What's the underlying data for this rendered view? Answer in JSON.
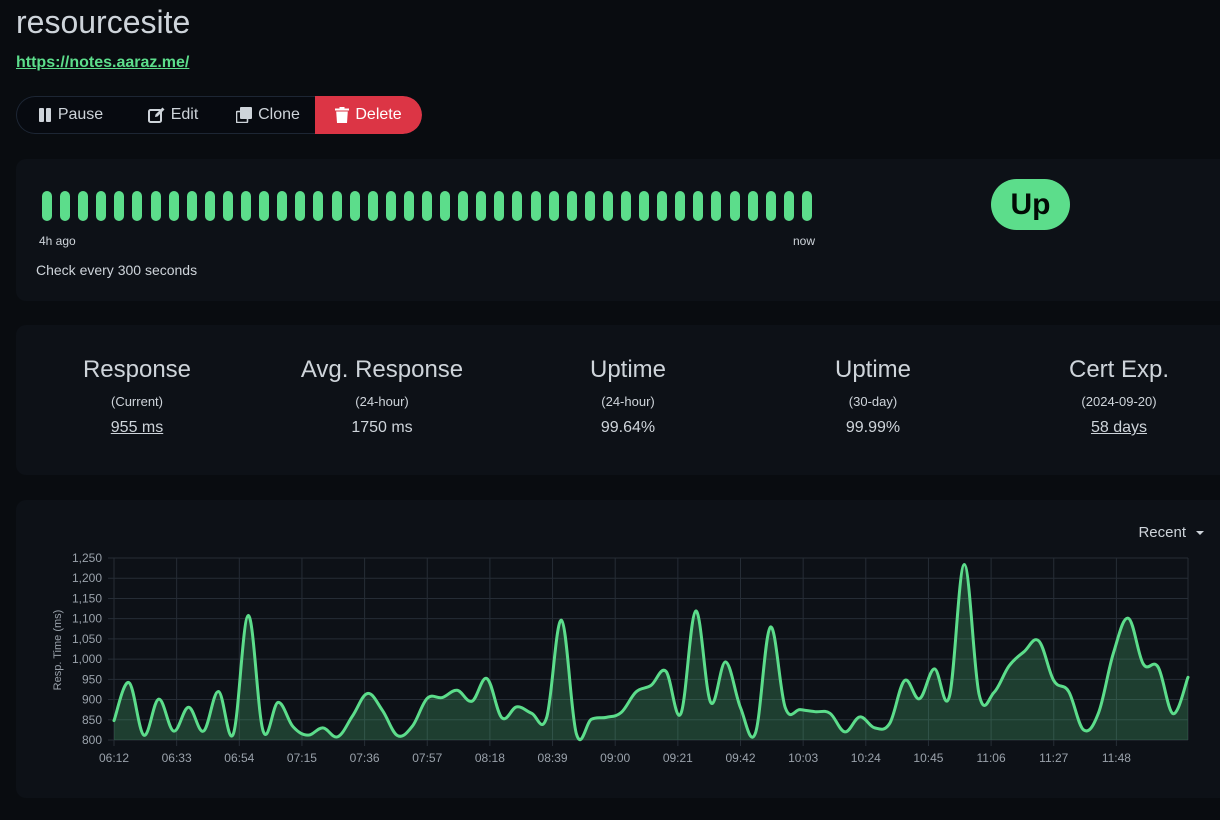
{
  "monitor": {
    "name": "resourcesite",
    "url": "https://notes.aaraz.me/"
  },
  "actions": {
    "pause": "Pause",
    "edit": "Edit",
    "clone": "Clone",
    "delete": "Delete"
  },
  "heartbeat": {
    "beat_count": 43,
    "beat_color": "#5cdd8b",
    "label_start": "4h ago",
    "label_end": "now",
    "check_text": "Check every 300 seconds",
    "status": "Up"
  },
  "stats": [
    {
      "title": "Response",
      "subtitle": "(Current)",
      "value": "955 ms",
      "link": true
    },
    {
      "title": "Avg. Response",
      "subtitle": "(24-hour)",
      "value": "1750 ms",
      "link": false
    },
    {
      "title": "Uptime",
      "subtitle": "(24-hour)",
      "value": "99.64%",
      "link": false
    },
    {
      "title": "Uptime",
      "subtitle": "(30-day)",
      "value": "99.99%",
      "link": false
    },
    {
      "title": "Cert Exp.",
      "subtitle": "(2024-09-20)",
      "value": "58 days",
      "link": true
    }
  ],
  "period_select": {
    "value": "Recent"
  },
  "colors": {
    "accent": "#5cdd8b",
    "danger": "#dc3545",
    "background": "#090c10",
    "card": "#0d1117"
  },
  "chart_data": {
    "type": "area",
    "ylabel": "Resp. Time (ms)",
    "xlabel": "",
    "ylim": [
      800,
      1250
    ],
    "yticks": [
      800,
      850,
      900,
      950,
      1000,
      1050,
      1100,
      1150,
      1200,
      1250
    ],
    "ytick_labels": [
      "800",
      "850",
      "900",
      "950",
      "1,000",
      "1,050",
      "1,100",
      "1,150",
      "1,200",
      "1,250"
    ],
    "xticks": [
      "06:12",
      "06:33",
      "06:54",
      "07:15",
      "07:36",
      "07:57",
      "08:18",
      "08:39",
      "09:00",
      "09:21",
      "09:42",
      "10:03",
      "10:24",
      "10:45",
      "11:06",
      "11:27",
      "11:48"
    ],
    "xtick_step_minutes": 21,
    "start_time": "06:12",
    "end_time": "12:02",
    "grid": true,
    "series": [
      {
        "color": "#5cdd8b",
        "points": [
          [
            "06:12",
            848
          ],
          [
            "06:17",
            942
          ],
          [
            "06:22",
            812
          ],
          [
            "06:27",
            901
          ],
          [
            "06:32",
            822
          ],
          [
            "06:37",
            881
          ],
          [
            "06:42",
            822
          ],
          [
            "06:47",
            920
          ],
          [
            "06:52",
            815
          ],
          [
            "06:57",
            1108
          ],
          [
            "07:02",
            822
          ],
          [
            "07:07",
            893
          ],
          [
            "07:12",
            833
          ],
          [
            "07:17",
            812
          ],
          [
            "07:22",
            830
          ],
          [
            "07:27",
            808
          ],
          [
            "07:32",
            860
          ],
          [
            "07:37",
            915
          ],
          [
            "07:42",
            873
          ],
          [
            "07:47",
            811
          ],
          [
            "07:52",
            834
          ],
          [
            "07:57",
            903
          ],
          [
            "08:02",
            905
          ],
          [
            "08:07",
            923
          ],
          [
            "08:12",
            896
          ],
          [
            "08:17",
            952
          ],
          [
            "08:22",
            855
          ],
          [
            "08:27",
            882
          ],
          [
            "08:32",
            866
          ],
          [
            "08:37",
            855
          ],
          [
            "08:42",
            1096
          ],
          [
            "08:47",
            815
          ],
          [
            "08:52",
            851
          ],
          [
            "08:57",
            856
          ],
          [
            "09:02",
            868
          ],
          [
            "09:07",
            919
          ],
          [
            "09:12",
            935
          ],
          [
            "09:17",
            970
          ],
          [
            "09:22",
            865
          ],
          [
            "09:27",
            1119
          ],
          [
            "09:32",
            893
          ],
          [
            "09:37",
            993
          ],
          [
            "09:42",
            880
          ],
          [
            "09:47",
            817
          ],
          [
            "09:52",
            1079
          ],
          [
            "09:57",
            880
          ],
          [
            "10:02",
            875
          ],
          [
            "10:07",
            870
          ],
          [
            "10:12",
            866
          ],
          [
            "10:17",
            820
          ],
          [
            "10:22",
            857
          ],
          [
            "10:27",
            830
          ],
          [
            "10:32",
            841
          ],
          [
            "10:37",
            947
          ],
          [
            "10:42",
            902
          ],
          [
            "10:47",
            976
          ],
          [
            "10:52",
            907
          ],
          [
            "10:57",
            1234
          ],
          [
            "11:02",
            912
          ],
          [
            "11:07",
            918
          ],
          [
            "11:12",
            983
          ],
          [
            "11:17",
            1018
          ],
          [
            "11:22",
            1045
          ],
          [
            "11:27",
            947
          ],
          [
            "11:32",
            920
          ],
          [
            "11:37",
            825
          ],
          [
            "11:42",
            867
          ],
          [
            "11:47",
            1015
          ],
          [
            "11:52",
            1101
          ],
          [
            "11:57",
            988
          ],
          [
            "12:02",
            980
          ],
          [
            "12:07",
            865
          ],
          [
            "12:12",
            955
          ]
        ]
      }
    ]
  }
}
